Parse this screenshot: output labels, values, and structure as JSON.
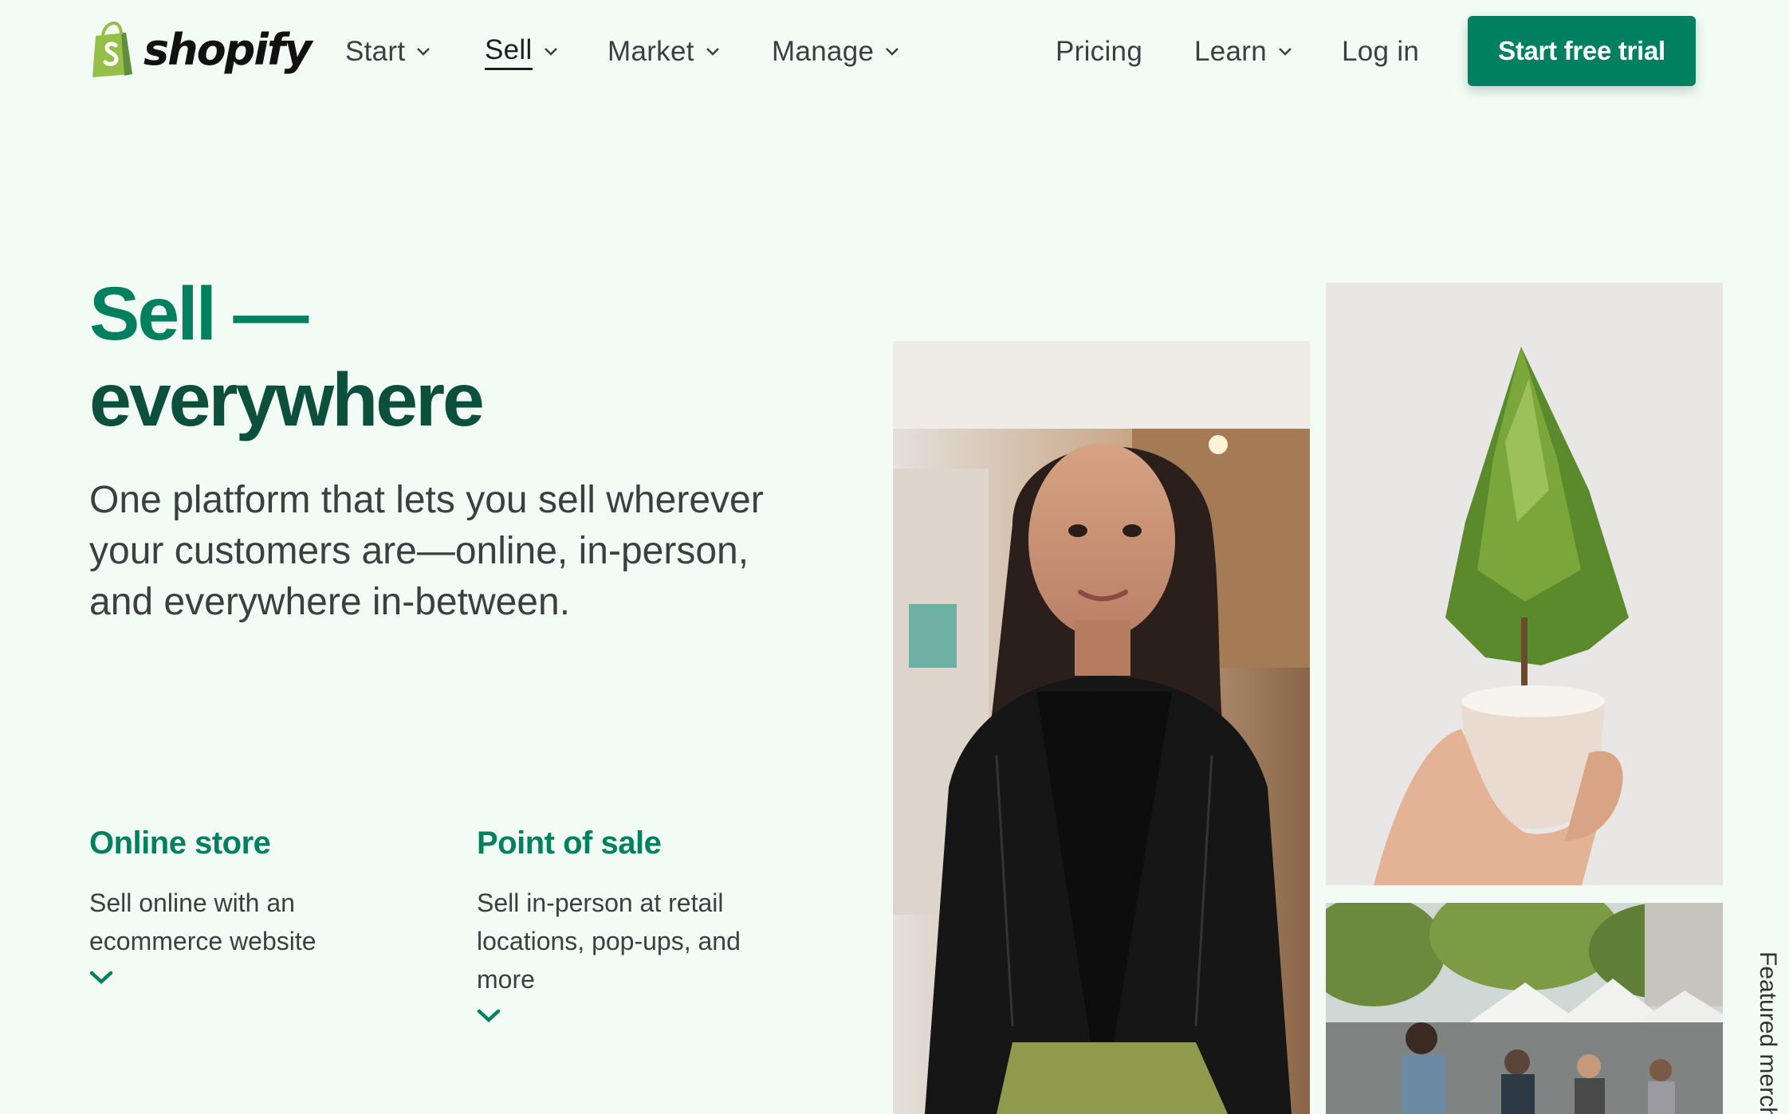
{
  "brand": {
    "name": "shopify"
  },
  "nav": {
    "items": [
      {
        "label": "Start",
        "dropdown": true
      },
      {
        "label": "Sell",
        "dropdown": true,
        "active": true
      },
      {
        "label": "Market",
        "dropdown": true
      },
      {
        "label": "Manage",
        "dropdown": true
      }
    ],
    "right_items": [
      {
        "label": "Pricing",
        "dropdown": false
      },
      {
        "label": "Learn",
        "dropdown": true
      },
      {
        "label": "Log in",
        "dropdown": false
      }
    ],
    "cta": "Start free trial"
  },
  "hero": {
    "title_line1": "Sell —",
    "title_line2": "everywhere",
    "subtitle": "One platform that lets you sell wherever your customers are—online, in-person, and everywhere in-between."
  },
  "features": [
    {
      "title": "Online store",
      "description": "Sell online with an ecommerce website"
    },
    {
      "title": "Point of sale",
      "description": "Sell in-person at retail locations, pop-ups, and more"
    }
  ],
  "side_tab": "Featured mercha",
  "colors": {
    "background": "#f3fcf4",
    "brand_green": "#008060",
    "title_dark_green": "#0c4f3c",
    "text": "#3a3f42"
  },
  "icons": {
    "logo": "shopping-bag-icon",
    "dropdown": "chevron-down-icon",
    "expand": "chevron-down-icon"
  }
}
